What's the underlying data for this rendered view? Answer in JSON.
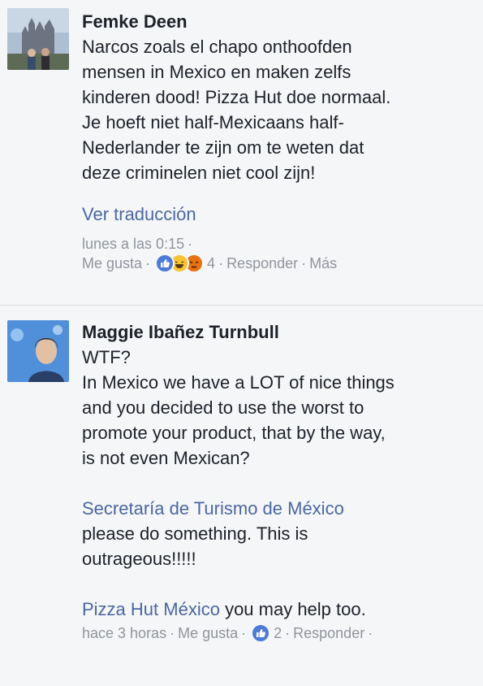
{
  "comments": [
    {
      "author": "Femke Deen",
      "lines": [
        "Narcos zoals el chapo onthoofden",
        "mensen in Mexico en maken zelfs",
        "kinderen dood! Pizza Hut doe normaal.",
        "Je hoeft niet half-Mexicaans half-",
        "Nederlander te zijn om te weten dat",
        "deze criminelen niet cool zijn!"
      ],
      "translate_label": "Ver traducción",
      "timestamp": "lunes a las 0:15",
      "like_label": "Me gusta",
      "reaction_count": "4",
      "reply_label": "Responder",
      "more_label": "Más",
      "reactions": [
        "like",
        "haha",
        "angry"
      ]
    },
    {
      "author": "Maggie Ibañez Turnbull",
      "lines": [
        "WTF?",
        "In Mexico we have a LOT of nice things",
        "and you decided to use the worst to",
        "promote your product, that by the way,",
        "is not even Mexican?"
      ],
      "mention1": "Secretaría de Turismo de México",
      "mention1_lines": [
        "please do something. This is",
        "outrageous!!!!!"
      ],
      "mention2": "Pizza Hut México",
      "mention2_text": " you may help too.",
      "timestamp": "hace 3 horas",
      "like_label": "Me gusta",
      "reaction_count": "2",
      "reply_label": "Responder",
      "reactions": [
        "like"
      ]
    }
  ],
  "colors": {
    "background": "#f5f6f7",
    "link": "#4b67a1",
    "meta": "#90949c",
    "text": "#1d2129",
    "like": "#4c7bd9"
  }
}
